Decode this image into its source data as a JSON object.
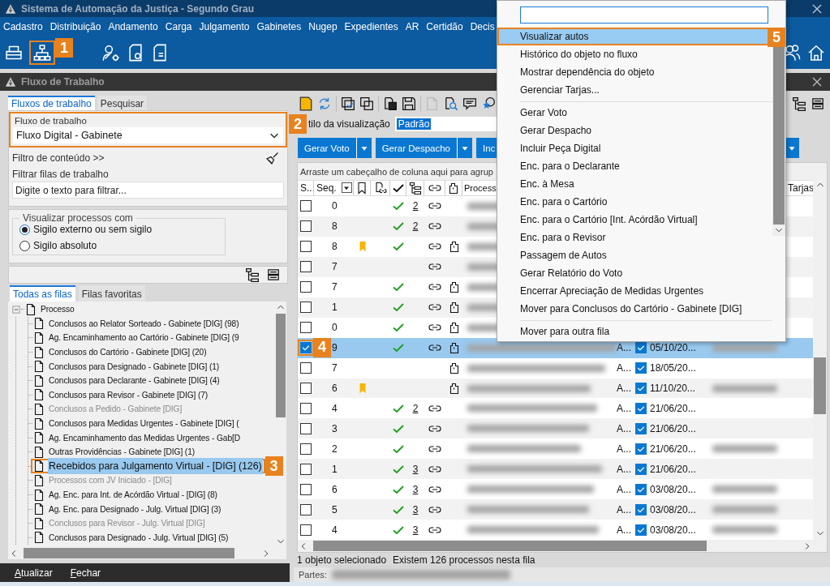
{
  "window": {
    "title": "Sistema de Automação da Justiça - Segundo Grau"
  },
  "menu": [
    "Cadastro",
    "Distribuição",
    "Andamento",
    "Carga",
    "Julgamento",
    "Gabinetes",
    "Nugep",
    "Expedientes",
    "AR",
    "Certidão",
    "Decis"
  ],
  "toolbar": {
    "callout": "1"
  },
  "panel": {
    "title": "Fluxo de Trabalho"
  },
  "left": {
    "tabs": [
      {
        "label": "Fluxos de trabalho",
        "selected": true
      },
      {
        "label": "Pesquisar",
        "selected": false
      }
    ],
    "workflow": {
      "label": "Fluxo de trabalho",
      "value": "Fluxo Digital - Gabinete",
      "callout": "2"
    },
    "content_filter": "Filtro de conteúdo >>",
    "queue_filter": {
      "label": "Filtrar filas de trabalho",
      "placeholder": "Digite o texto para filtrar..."
    },
    "visibility": {
      "legend": "Visualizar processos com",
      "options": [
        {
          "label": "Sigilo externo ou sem sigilo",
          "selected": true
        },
        {
          "label": "Sigilo absoluto",
          "selected": false
        }
      ]
    },
    "queue_tabs": [
      {
        "label": "Todas as filas",
        "selected": true
      },
      {
        "label": "Filas favoritas",
        "selected": false
      }
    ],
    "tree": {
      "label": "Processo",
      "expanded": true,
      "children": [
        {
          "label": "Conclusos ao Relator Sorteado - Gabinete [DIG] (98)",
          "selected": false,
          "disabled": false
        },
        {
          "label": "Ag. Encaminhamento ao Cartório - Gabinete [DIG] (9",
          "selected": false,
          "disabled": false
        },
        {
          "label": "Conclusos do Cartório - Gabinete [DIG] (20)",
          "selected": false,
          "disabled": false
        },
        {
          "label": "Conclusos para Designado - Gabinete [DIG] (1)",
          "selected": false,
          "disabled": false
        },
        {
          "label": "Conclusos para Declarante - Gabinete [DIG] (4)",
          "selected": false,
          "disabled": false
        },
        {
          "label": "Conclusos para Revisor - Gabinete [DIG] (7)",
          "selected": false,
          "disabled": false
        },
        {
          "label": "Conclusos a Pedido - Gabinete [DIG]",
          "selected": false,
          "disabled": true
        },
        {
          "label": "Conclusos para Medidas Urgentes - Gabinete [DIG] (",
          "selected": false,
          "disabled": false
        },
        {
          "label": "Ag. Encaminhamento das Medidas Urgentes - Gab[D",
          "selected": false,
          "disabled": false
        },
        {
          "label": "Outras Providências - Gabinete [DIG] (1)",
          "selected": false,
          "disabled": false
        },
        {
          "label": "Recebidos para Julgamento Virtual - [DIG] (126)",
          "selected": true,
          "disabled": false,
          "callout": "3"
        },
        {
          "label": "Processos com JV Iniciado - [DIG]",
          "selected": false,
          "disabled": true
        },
        {
          "label": "Ag. Enc. para Int. de Acórdão Virtual - [DIG] (8)",
          "selected": false,
          "disabled": false
        },
        {
          "label": "Ag. Enc. para Designado - Julg. Virtual [DIG] (3)",
          "selected": false,
          "disabled": false
        },
        {
          "label": "Conclusos para Revisor - Julg. Virtual [DIG]",
          "selected": false,
          "disabled": true
        },
        {
          "label": "Conclusos para Designado - Julg. Virtual [DIG] (5)",
          "selected": false,
          "disabled": false
        }
      ]
    },
    "footer": [
      "Atualizar",
      "Fechar"
    ]
  },
  "right": {
    "view_style": {
      "label": "tilo da visualização",
      "value": "Padrão"
    },
    "actions": [
      {
        "label": "Gerar Voto",
        "kind": "split"
      },
      {
        "label": "Gerar Despacho",
        "kind": "split"
      },
      {
        "label": "Inc",
        "kind": "plain"
      }
    ],
    "group_hint": "Arraste um cabeçalho de coluna aqui para agrup",
    "header": {
      "select": "S...",
      "seq": "Seq.",
      "process": "Process",
      "tags": "Tarjas"
    },
    "rows": [
      {
        "seq": "0",
        "bookmarked": false,
        "done": true,
        "count": "2",
        "linked": true,
        "attached": false,
        "selected": false
      },
      {
        "seq": "8",
        "bookmarked": false,
        "done": true,
        "count": "2",
        "linked": true,
        "attached": false,
        "selected": false
      },
      {
        "seq": "8",
        "bookmarked": true,
        "done": true,
        "linked": true,
        "attached": true,
        "selected": false
      },
      {
        "seq": "7",
        "bookmarked": false,
        "done": false,
        "linked": true,
        "attached": false,
        "selected": false
      },
      {
        "seq": "7",
        "bookmarked": false,
        "done": true,
        "linked": true,
        "attached": true,
        "selected": false
      },
      {
        "seq": "1",
        "bookmarked": false,
        "done": true,
        "linked": true,
        "attached": true,
        "selected": false
      },
      {
        "seq": "0",
        "bookmarked": false,
        "done": true,
        "linked": true,
        "attached": true,
        "selected": false
      },
      {
        "seq": "9",
        "bookmarked": false,
        "done": true,
        "linked": true,
        "attached": true,
        "selected": true,
        "callout": "4",
        "type": "A...",
        "flagged": true,
        "date": "05/10/20..."
      },
      {
        "seq": "7",
        "bookmarked": false,
        "done": false,
        "linked": false,
        "attached": true,
        "selected": false,
        "type": "A...",
        "flagged": true,
        "date": "18/05/20..."
      },
      {
        "seq": "6",
        "bookmarked": true,
        "done": false,
        "linked": false,
        "attached": true,
        "selected": false,
        "type": "A...",
        "flagged": true,
        "date": "11/10/20..."
      },
      {
        "seq": "4",
        "bookmarked": false,
        "done": true,
        "count": "2",
        "linked": true,
        "attached": false,
        "selected": false,
        "type": "A...",
        "flagged": true,
        "date": "21/06/20..."
      },
      {
        "seq": "3",
        "bookmarked": false,
        "done": true,
        "linked": true,
        "attached": false,
        "selected": false,
        "type": "A...",
        "flagged": true,
        "date": "21/06/20..."
      },
      {
        "seq": "2",
        "bookmarked": false,
        "done": true,
        "linked": true,
        "attached": false,
        "selected": false,
        "type": "A...",
        "flagged": true,
        "date": "21/06/20..."
      },
      {
        "seq": "1",
        "bookmarked": false,
        "done": true,
        "count": "3",
        "linked": true,
        "attached": false,
        "selected": false,
        "type": "A...",
        "flagged": true,
        "date": "21/06/20..."
      },
      {
        "seq": "6",
        "bookmarked": false,
        "done": true,
        "count": "3",
        "linked": true,
        "attached": false,
        "selected": false,
        "type": "A...",
        "flagged": true,
        "date": "03/08/20..."
      },
      {
        "seq": "5",
        "bookmarked": false,
        "done": true,
        "count": "3",
        "linked": true,
        "attached": false,
        "selected": false,
        "type": "A...",
        "flagged": true,
        "date": "03/08/20..."
      },
      {
        "seq": "4",
        "bookmarked": false,
        "done": true,
        "count": "3",
        "linked": true,
        "attached": false,
        "selected": false,
        "type": "A...",
        "flagged": true,
        "date": "03/08/20..."
      }
    ],
    "status": [
      "1 objeto selecionado",
      "Existem 126 processos nesta fila"
    ],
    "parties_label": "Partes:"
  },
  "context_menu": {
    "items": [
      {
        "kind": "item",
        "label": "Visualizar autos",
        "selected": true,
        "callout": "5"
      },
      {
        "kind": "item",
        "label": "Histórico do objeto no fluxo",
        "selected": false
      },
      {
        "kind": "item",
        "label": "Mostrar dependência do objeto",
        "selected": false
      },
      {
        "kind": "item",
        "label": "Gerenciar Tarjas...",
        "selected": false
      },
      {
        "kind": "separator"
      },
      {
        "kind": "item",
        "label": "Gerar Voto",
        "selected": false
      },
      {
        "kind": "item",
        "label": "Gerar Despacho",
        "selected": false
      },
      {
        "kind": "item",
        "label": "Incluir Peça Digital",
        "selected": false
      },
      {
        "kind": "item",
        "label": "Enc. para o Declarante",
        "selected": false
      },
      {
        "kind": "item",
        "label": "Enc. à Mesa",
        "selected": false
      },
      {
        "kind": "item",
        "label": "Enc. para o Cartório",
        "selected": false
      },
      {
        "kind": "item",
        "label": "Enc. para o Cartório [Int. Acórdão Virtual]",
        "selected": false
      },
      {
        "kind": "item",
        "label": "Enc. para o Revisor",
        "selected": false
      },
      {
        "kind": "item",
        "label": "Passagem de Autos",
        "selected": false
      },
      {
        "kind": "item",
        "label": "Gerar Relatório do Voto",
        "selected": false
      },
      {
        "kind": "item",
        "label": "Encerrar Apreciação de Medidas Urgentes",
        "selected": false
      },
      {
        "kind": "item",
        "label": "Mover para Conclusos do Cartório - Gabinete [DIG]",
        "selected": false
      },
      {
        "kind": "separator"
      },
      {
        "kind": "item",
        "label": "Mover para outra fila",
        "selected": false
      }
    ]
  }
}
